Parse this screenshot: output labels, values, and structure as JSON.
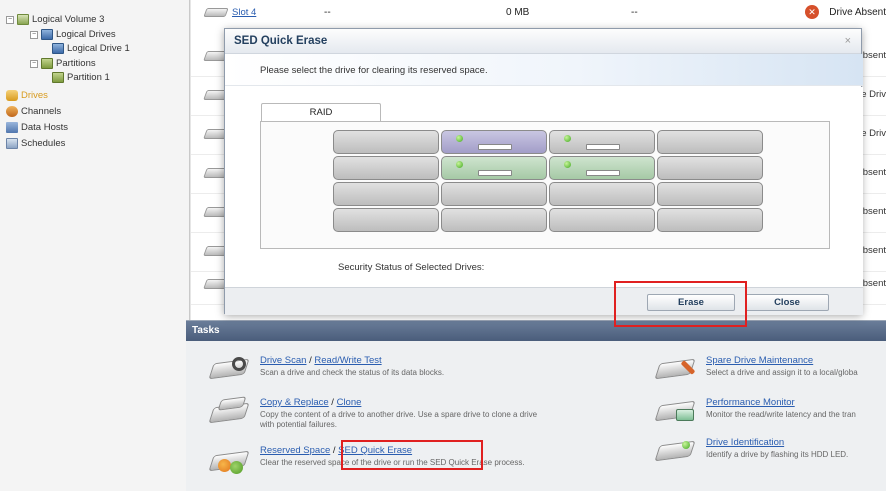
{
  "tree": {
    "items": [
      {
        "label": "Logical Volume 3"
      },
      {
        "label": "Logical Drives"
      },
      {
        "label": "Logical Drive 1"
      },
      {
        "label": "Partitions"
      },
      {
        "label": "Partition 1"
      },
      {
        "label": "Drives"
      },
      {
        "label": "Channels"
      },
      {
        "label": "Data Hosts"
      },
      {
        "label": "Schedules"
      }
    ]
  },
  "drive_list": {
    "first_row": {
      "slot": "Slot 4",
      "dash1": "--",
      "size": "0 MB",
      "dash2": "--",
      "status": "Drive Absent"
    },
    "right_texts": [
      "Absent",
      "ne Driv",
      "ne Driv",
      "Absent",
      "Absent",
      "Absent",
      "Absent"
    ]
  },
  "modal": {
    "title": "SED Quick Erase",
    "close_glyph": "×",
    "instruction": "Please select the drive for clearing its reserved space.",
    "tab_label": "RAID",
    "security_status_label": "Security Status of Selected Drives:",
    "erase_label": "Erase",
    "close_label": "Close"
  },
  "tasks": {
    "header": "Tasks",
    "items": [
      {
        "link1": "Drive Scan",
        "sep": " / ",
        "link2": "Read/Write Test",
        "desc": "Scan a drive and check the status of its data blocks."
      },
      {
        "link1": "Copy & Replace",
        "sep": " / ",
        "link2": "Clone",
        "desc": "Copy the content of a drive to another drive. Use a spare drive to clone a drive",
        "desc2": "with potential failures."
      },
      {
        "link1": "Reserved Space",
        "sep": " / ",
        "link2": "SED Quick Erase",
        "desc": "Clear the reserved space of the drive or run the SED Quick Erase process."
      },
      {
        "link1": "Spare Drive Maintenance",
        "desc": "Select a drive and assign it to a local/globa"
      },
      {
        "link1": "Performance Monitor",
        "desc": "Monitor the read/write latency and the tran"
      },
      {
        "link1": "Drive Identification",
        "desc": "Identify a drive by flashing its HDD LED."
      }
    ]
  }
}
